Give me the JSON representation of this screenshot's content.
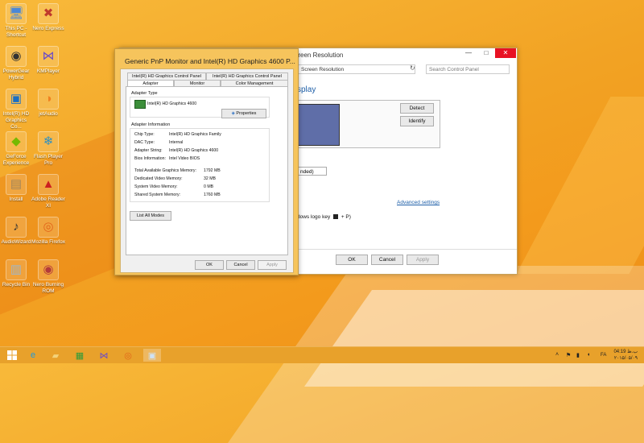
{
  "desktop": {
    "icons": [
      {
        "label": "This PC - Shortcut",
        "color": "#4a88d8",
        "glyph": "🖥"
      },
      {
        "label": "Nero Express",
        "color": "#c0392b",
        "glyph": "✖"
      },
      {
        "label": "PowerGear Hybrid",
        "color": "#333333",
        "glyph": "◉"
      },
      {
        "label": "KMPlayer",
        "color": "#6a4cc9",
        "glyph": "⋈"
      },
      {
        "label": "Intel(R) HD Graphics Co...",
        "color": "#1a6fc4",
        "glyph": "▣"
      },
      {
        "label": "jetAudio",
        "color": "#f08020",
        "glyph": "◑"
      },
      {
        "label": "GeForce Experience",
        "color": "#76b900",
        "glyph": "◆"
      },
      {
        "label": "Flash Player Pro",
        "color": "#2a8fc4",
        "glyph": "❄"
      },
      {
        "label": "Install",
        "color": "#a0855b",
        "glyph": "▤"
      },
      {
        "label": "Adobe Reader XI",
        "color": "#cc2020",
        "glyph": "▲"
      },
      {
        "label": "AudioWizard",
        "color": "#333333",
        "glyph": "♪"
      },
      {
        "label": "Mozilla Firefox",
        "color": "#e2641a",
        "glyph": "◎"
      },
      {
        "label": "Recycle Bin",
        "color": "#9fb6c8",
        "glyph": "▥"
      },
      {
        "label": "Nero Burning ROM",
        "color": "#b33a3a",
        "glyph": "◉"
      }
    ]
  },
  "screen_resolution": {
    "title": "Screen Resolution",
    "address": "Screen Resolution",
    "search_placeholder": "Search Control Panel",
    "heading": "splay",
    "detect": "Detect",
    "identify": "Identify",
    "orientation_value": "nded)",
    "advanced_link": "Advanced settings",
    "hint": "dows logo key",
    "hint_suffix": "+ P)",
    "ok": "OK",
    "cancel": "Cancel",
    "apply": "Apply",
    "minimize": "—",
    "maximize": "□",
    "close": "✕"
  },
  "properties_dialog": {
    "title": "Generic PnP Monitor and Intel(R) HD Graphics 4600 P...",
    "tabs_top": [
      "Intel(R) HD Graphics Control Panel",
      "Intel(R) HD Graphics Control Panel"
    ],
    "tabs_bottom": [
      "Adapter",
      "Monitor",
      "Color Management"
    ],
    "adapter_type_label": "Adapter Type",
    "adapter_name": "Intel(R) HD Graphics 4600",
    "properties_button": "Properties",
    "adapter_info_label": "Adapter Information",
    "info": [
      {
        "k": "Chip Type:",
        "v": "Intel(R) HD Graphics Family"
      },
      {
        "k": "DAC Type:",
        "v": "Internal"
      },
      {
        "k": "Adapter String:",
        "v": "Intel(R) HD Graphics 4600"
      },
      {
        "k": "Bios Information:",
        "v": "Intel Video BIOS"
      }
    ],
    "memory": [
      {
        "k": "Total Available Graphics Memory:",
        "v": "1792 MB"
      },
      {
        "k": "Dedicated Video Memory:",
        "v": "32 MB"
      },
      {
        "k": "System Video Memory:",
        "v": "0 MB"
      },
      {
        "k": "Shared System Memory:",
        "v": "1760 MB"
      }
    ],
    "list_modes": "List All Modes",
    "ok": "OK",
    "cancel": "Cancel",
    "apply": "Apply"
  },
  "taskbar": {
    "time": "04:19 ب.ظ",
    "date": "۲۰۱۵/۰۵/۰۹",
    "lang": "FA"
  }
}
